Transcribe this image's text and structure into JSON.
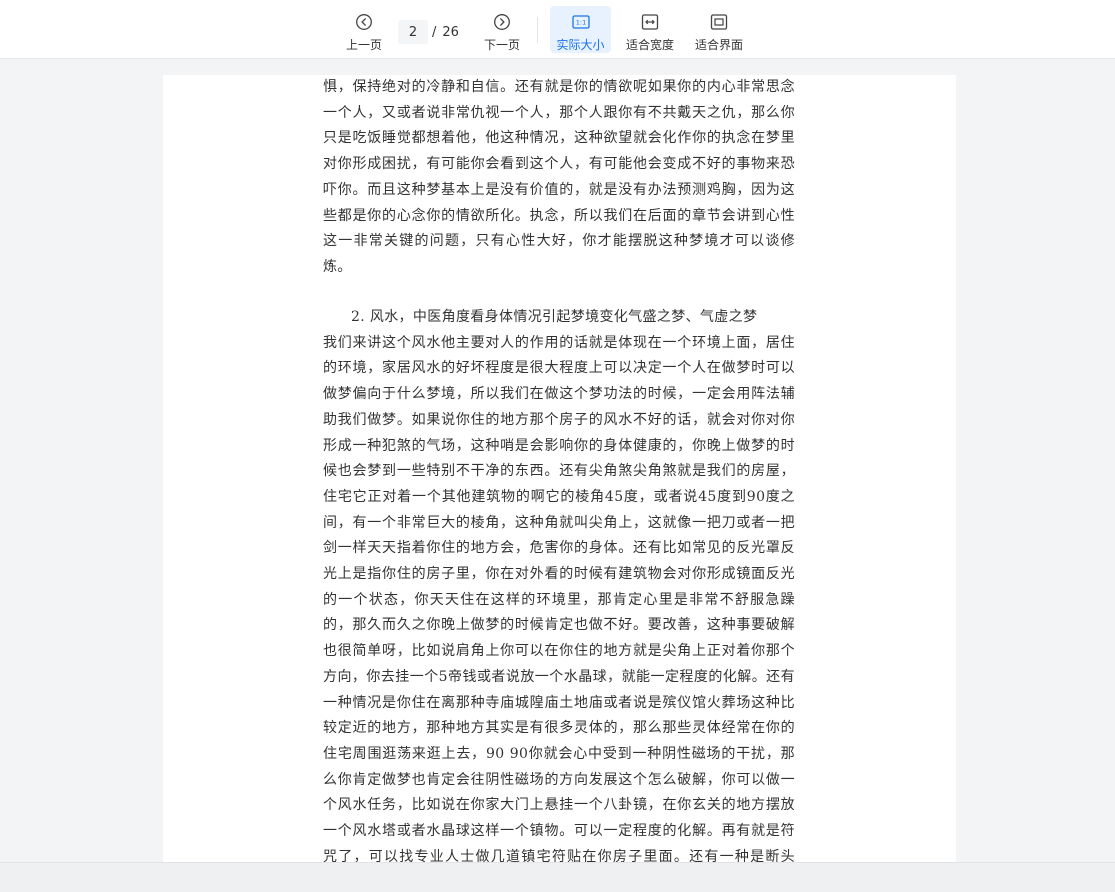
{
  "toolbar": {
    "prev_label": "上一页",
    "next_label": "下一页",
    "current_page": "2",
    "page_separator": "/",
    "total_pages": "26",
    "actual_size_label": "实际大小",
    "fit_width_label": "适合宽度",
    "fit_page_label": "适合界面",
    "actual_size_icon_text": "1:1",
    "accent_color": "#1a73e8"
  },
  "document": {
    "paragraph_1": "惧，保持绝对的冷静和自信。还有就是你的情欲呢如果你的内心非常思念一个人，又或者说非常仇视一个人，那个人跟你有不共戴天之仇，那么你只是吃饭睡觉都想着他，他这种情况，这种欲望就会化作你的执念在梦里对你形成困扰，有可能你会看到这个人，有可能他会变成不好的事物来恐吓你。而且这种梦基本上是没有价值的，就是没有办法预测鸡胸，因为这些都是你的心念你的情欲所化。执念，所以我们在后面的章节会讲到心性这一非常关键的问题，只有心性大好，你才能摆脱这种梦境才可以谈修炼。",
    "section_heading": "2. 风水，中医角度看身体情况引起梦境变化气盛之梦、气虚之梦",
    "paragraph_2": "我们来讲这个风水他主要对人的作用的话就是体现在一个环境上面，居住的环境，家居风水的好坏程度是很大程度上可以决定一个人在做梦时可以做梦偏向于什么梦境，所以我们在做这个梦功法的时候，一定会用阵法辅助我们做梦。如果说你住的地方那个房子的风水不好的话，就会对你对你形成一种犯煞的气场，这种哨是会影响你的身体健康的，你晚上做梦的时候也会梦到一些特别不干净的东西。还有尖角煞尖角煞就是我们的房屋，住宅它正对着一个其他建筑物的啊它的棱角45度，或者说45度到90度之间，有一个非常巨大的棱角，这种角就叫尖角上，这就像一把刀或者一把剑一样天天指着你住的地方会，危害你的身体。还有比如常见的反光罩反光上是指你住的房子里，你在对外看的时候有建筑物会对你形成镜面反光的一个状态，你天天住在这样的环境里，那肯定心里是非常不舒服急躁的，那久而久之你晚上做梦的时候肯定也做不好。要改善，这种事要破解也很简单呀，比如说肩角上你可以在你住的地方就是尖角上正对着你那个方向，你去挂一个5帝钱或者说放一个水晶球，就能一定程度的化解。还有一种情况是你住在离那种寺庙城隍庙土地庙或者说是殡仪馆火葬场这种比较定近的地方，那种地方其实是有很多灵体的，那么那些灵体经常在你的住宅周围逛荡来逛上去，90 90你就会心中受到一种阴性磁场的干扰，那么你肯定做梦也肯定会往阴性磁场的方向发展这个怎么破解，你可以做一个风水任务，比如说在你家大门上悬挂一个八卦镜，在你玄关的地方摆放一个风水塔或者水晶球这样一个镇物。可以一定程度的化解。再有就是符咒了，可以找专业人士做几道镇宅符贴在你房子里面。还有一种是断头煞，是指你睡觉的床上有一道巨大的房梁就横在床上，"
  }
}
